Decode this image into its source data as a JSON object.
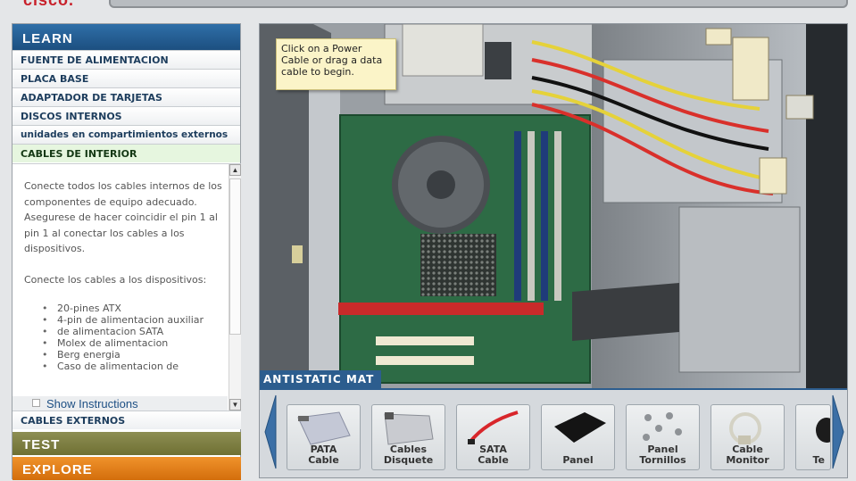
{
  "header": {
    "logo_text": "cisco."
  },
  "sidebar": {
    "learn_label": "LEARN",
    "items": [
      {
        "label": "FUENTE DE ALIMENTACION"
      },
      {
        "label": "PLACA BASE"
      },
      {
        "label": "ADAPTADOR DE TARJETAS"
      },
      {
        "label": "DISCOS INTERNOS"
      },
      {
        "label": "unidades en compartimientos externos"
      },
      {
        "label": "CABLES DE INTERIOR",
        "active": true
      }
    ],
    "description": {
      "para1": "Conecte todos los cables internos de los componentes de equipo adecuado. Asegurese de hacer coincidir el pin 1 al pin 1 al conectar los cables a los dispositivos.",
      "para2": "Conecte los cables a los dispositivos:",
      "bullets": [
        "20-pines ATX",
        "4-pin de alimentacion auxiliar",
        "de alimentacion SATA",
        "Molex de alimentacion",
        "Berg energia",
        "Caso de alimentacion de"
      ]
    },
    "show_instructions_label": "Show Instructions",
    "external_cables_label": "CABLES EXTERNOS",
    "test_label": "TEST",
    "explore_label": "EXPLORE"
  },
  "workspace": {
    "tooltip": "Click on a Power Cable or drag a data cable to begin.",
    "mat_label": "ANTISTATIC MAT",
    "tray_items": [
      {
        "label": "PATA\nCable",
        "icon": "pata-cable-icon"
      },
      {
        "label": "Cables\nDisquete",
        "icon": "floppy-cable-icon"
      },
      {
        "label": "SATA\nCable",
        "icon": "sata-cable-icon"
      },
      {
        "label": "Panel",
        "icon": "panel-icon"
      },
      {
        "label": "Panel\nTornillos",
        "icon": "screws-icon"
      },
      {
        "label": "Cable\nMonitor",
        "icon": "monitor-cable-icon"
      },
      {
        "label": "Te",
        "icon": "partial-item-icon"
      }
    ]
  }
}
